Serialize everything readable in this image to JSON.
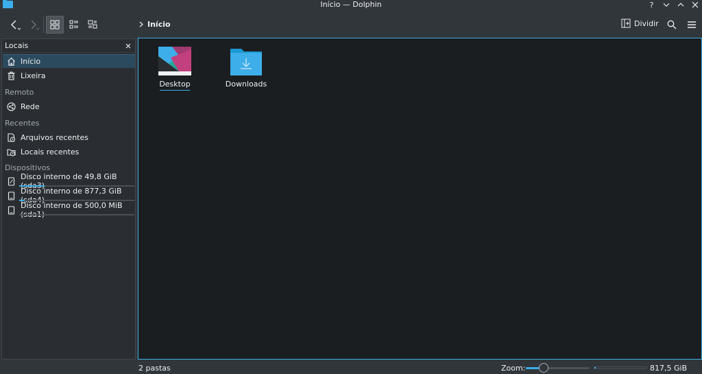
{
  "window": {
    "title": "Início — Dolphin"
  },
  "toolbar": {
    "breadcrumb": "Início",
    "split_label": "Dividir"
  },
  "places": {
    "header": "Locais",
    "items": [
      {
        "label": "Início",
        "icon": "home-icon",
        "active": true
      },
      {
        "label": "Lixeira",
        "icon": "trash-icon"
      }
    ],
    "remote_title": "Remoto",
    "remote_items": [
      {
        "label": "Rede",
        "icon": "network-icon"
      }
    ],
    "recent_title": "Recentes",
    "recent_items": [
      {
        "label": "Arquivos recentes",
        "icon": "recent-files-icon"
      },
      {
        "label": "Locais recentes",
        "icon": "recent-places-icon"
      }
    ],
    "devices_title": "Dispositivos",
    "devices": [
      {
        "label": "Disco interno de 49,8 GiB (sda3)",
        "usage": 0.22
      },
      {
        "label": "Disco interno de 877,3 GiB (sda4)",
        "usage": 0.05
      },
      {
        "label": "Disco interno de 500,0 MiB (sda1)",
        "usage": 0.0
      }
    ]
  },
  "files": [
    {
      "name": "Desktop",
      "icon": "desktop-folder-icon"
    },
    {
      "name": "Downloads",
      "icon": "downloads-folder-icon"
    }
  ],
  "status": {
    "count": "2 pastas",
    "zoom_label": "Zoom:",
    "zoom_level": 0.2,
    "free_space": "817,5 GiB livres",
    "disk_usage": 0.03
  },
  "colors": {
    "accent": "#3daee9",
    "background": "#31363b",
    "view_bg": "#1b1e20"
  }
}
